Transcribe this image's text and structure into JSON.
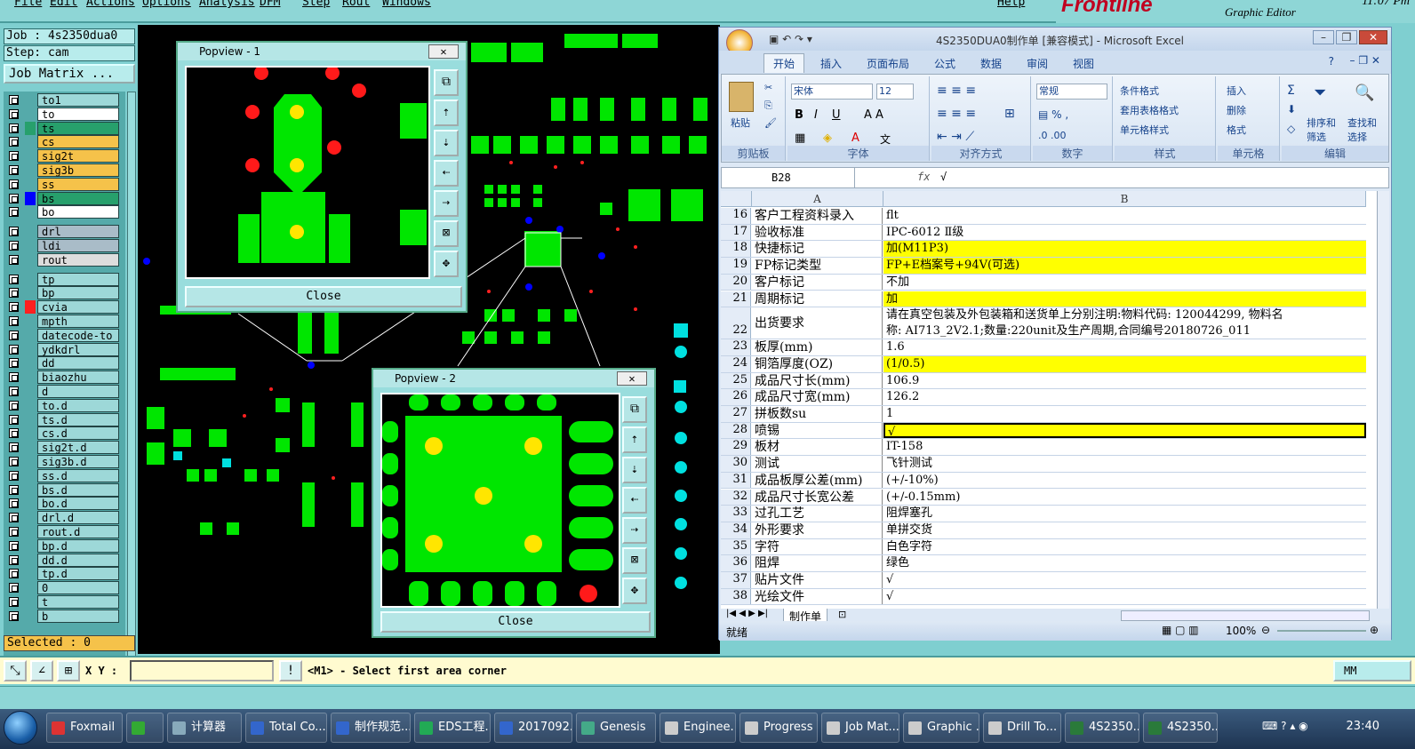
{
  "genesis": {
    "menu": [
      "File",
      "Edit",
      "Actions",
      "Options",
      "Analysis",
      "DFM",
      "Step",
      "Rout",
      "Windows",
      "Help"
    ],
    "brand": "Frontline",
    "brand_sub": "Graphic Editor",
    "time": "11:07 Pm",
    "job": "Job : 4s2350dua0",
    "step": "Step: cam",
    "job_matrix": "Job Matrix ...",
    "selected": "Selected : 0",
    "layers": [
      {
        "name": "to1",
        "color": "#9dd8d8"
      },
      {
        "name": "to",
        "color": "#ffffff"
      },
      {
        "name": "ts",
        "color": "#27a06c"
      },
      {
        "name": "cs",
        "color": "#f5c24a"
      },
      {
        "name": "sig2t",
        "color": "#f5c24a"
      },
      {
        "name": "sig3b",
        "color": "#f5c24a"
      },
      {
        "name": "ss",
        "color": "#f5c24a"
      },
      {
        "name": "bs",
        "color": "#27a06c"
      },
      {
        "name": "bo",
        "color": "#ffffff"
      },
      {
        "name": "drl",
        "color": "#a9bcc8"
      },
      {
        "name": "ldi",
        "color": "#a9bcc8"
      },
      {
        "name": "rout",
        "color": "#dddddd"
      },
      {
        "name": "tp",
        "color": "#9dd8d8"
      },
      {
        "name": "bp",
        "color": "#9dd8d8"
      },
      {
        "name": "cvia",
        "color": "#9dd8d8"
      },
      {
        "name": "mpth",
        "color": "#9dd8d8"
      },
      {
        "name": "datecode-to",
        "color": "#9dd8d8"
      },
      {
        "name": "ydkdrl",
        "color": "#9dd8d8"
      },
      {
        "name": "dd",
        "color": "#9dd8d8"
      },
      {
        "name": "biaozhu",
        "color": "#9dd8d8"
      },
      {
        "name": "d",
        "color": "#9dd8d8"
      },
      {
        "name": "to.d",
        "color": "#9dd8d8"
      },
      {
        "name": "ts.d",
        "color": "#9dd8d8"
      },
      {
        "name": "cs.d",
        "color": "#9dd8d8"
      },
      {
        "name": "sig2t.d",
        "color": "#9dd8d8"
      },
      {
        "name": "sig3b.d",
        "color": "#9dd8d8"
      },
      {
        "name": "ss.d",
        "color": "#9dd8d8"
      },
      {
        "name": "bs.d",
        "color": "#9dd8d8"
      },
      {
        "name": "bo.d",
        "color": "#9dd8d8"
      },
      {
        "name": "drl.d",
        "color": "#9dd8d8"
      },
      {
        "name": "rout.d",
        "color": "#9dd8d8"
      },
      {
        "name": "bp.d",
        "color": "#9dd8d8"
      },
      {
        "name": "dd.d",
        "color": "#9dd8d8"
      },
      {
        "name": "tp.d",
        "color": "#9dd8d8"
      },
      {
        "name": "0",
        "color": "#9dd8d8"
      },
      {
        "name": "t",
        "color": "#9dd8d8"
      },
      {
        "name": "b",
        "color": "#9dd8d8"
      }
    ],
    "popup1_title": "Popview - 1",
    "popup2_title": "Popview - 2",
    "close_label": "Close",
    "xy_label": "X Y :",
    "prompt": "<M1> - Select first area corner",
    "units": "MM"
  },
  "excel": {
    "title": "4S2350DUA0制作单 [兼容模式] - Microsoft Excel",
    "tabs": [
      "开始",
      "插入",
      "页面布局",
      "公式",
      "数据",
      "审阅",
      "视图"
    ],
    "font_name": "宋体",
    "font_size": "12",
    "number_format": "常规",
    "groups": [
      "剪贴板",
      "字体",
      "对齐方式",
      "数字",
      "样式",
      "单元格",
      "编辑"
    ],
    "paste": "粘贴",
    "styles": [
      "条件格式",
      "套用表格格式",
      "单元格样式"
    ],
    "cells_btns": [
      "插入",
      "删除",
      "格式"
    ],
    "sort": "排序和筛选",
    "find": "查找和选择",
    "name_box": "B28",
    "formula": "√",
    "col_a": "A",
    "col_b": "B",
    "rows": [
      {
        "n": "16",
        "a": "客户工程资料录入",
        "b": "flt",
        "hl": false
      },
      {
        "n": "17",
        "a": "验收标准",
        "b": "IPC-6012 Ⅱ级",
        "hl": false
      },
      {
        "n": "18",
        "a": "快捷标记",
        "b": "加(M11P3)",
        "hl": true
      },
      {
        "n": "19",
        "a": "FP标记类型",
        "b": "FP+E档案号+94V(可选)",
        "hl": true
      },
      {
        "n": "20",
        "a": "客户标记",
        "b": "不加",
        "hl": false
      },
      {
        "n": "21",
        "a": "周期标记",
        "b": "加",
        "hl": true
      },
      {
        "n": "22",
        "a": "出货要求",
        "b": "请在真空包装及外包装箱和送货单上分别注明:物料代码: 120044299, 物料名",
        "b2": "称: AI713_2V2.1;数量:220unit及生产周期,合同编号20180726_011",
        "hl": false,
        "tall": true
      },
      {
        "n": "23",
        "a": "板厚(mm)",
        "b": "1.6",
        "hl": false
      },
      {
        "n": "24",
        "a": "铜箔厚度(OZ)",
        "b": " (1/0.5)",
        "hl": true
      },
      {
        "n": "25",
        "a": "成品尺寸长(mm)",
        "b": "106.9",
        "hl": false
      },
      {
        "n": "26",
        "a": "成品尺寸宽(mm)",
        "b": "126.2",
        "hl": false
      },
      {
        "n": "27",
        "a": "拼板数su",
        "b": "1",
        "hl": false
      },
      {
        "n": "28",
        "a": "喷锡",
        "b": "√",
        "hl": true
      },
      {
        "n": "29",
        "a": "板材",
        "b": "IT-158",
        "hl": false
      },
      {
        "n": "30",
        "a": "测试",
        "b": "飞针测试",
        "hl": false
      },
      {
        "n": "31",
        "a": "成品板厚公差(mm)",
        "b": "(+/-10%)",
        "hl": false
      },
      {
        "n": "32",
        "a": "成品尺寸长宽公差",
        "b": "(+/-0.15mm)",
        "hl": false
      },
      {
        "n": "33",
        "a": "过孔工艺",
        "b": "阻焊塞孔",
        "hl": false
      },
      {
        "n": "34",
        "a": "外形要求",
        "b": "单拼交货",
        "hl": false
      },
      {
        "n": "35",
        "a": "字符",
        "b": "白色字符",
        "hl": false
      },
      {
        "n": "36",
        "a": "阻焊",
        "b": "绿色",
        "hl": false
      },
      {
        "n": "37",
        "a": "贴片文件",
        "b": "√",
        "hl": false
      },
      {
        "n": "38",
        "a": "光绘文件",
        "b": "√",
        "hl": false
      }
    ],
    "sheet_tab": "制作单",
    "status": "就绪",
    "zoom": "100%"
  },
  "taskbar": {
    "items": [
      {
        "label": "Foxmail",
        "color": "#d33"
      },
      {
        "label": "",
        "color": "#3a3"
      },
      {
        "label": "计算器",
        "color": "#8ab"
      },
      {
        "label": "Total Co...",
        "color": "#36c"
      },
      {
        "label": "制作规范...",
        "color": "#36c"
      },
      {
        "label": "EDS工程...",
        "color": "#2a5"
      },
      {
        "label": "2017092...",
        "color": "#36c"
      },
      {
        "label": "Genesis",
        "color": "#4a8"
      },
      {
        "label": "Enginee...",
        "color": "#ccc"
      },
      {
        "label": "Progress",
        "color": "#ccc"
      },
      {
        "label": "Job Mat...",
        "color": "#ccc"
      },
      {
        "label": "Graphic ...",
        "color": "#ccc"
      },
      {
        "label": "Drill To...",
        "color": "#ccc"
      },
      {
        "label": "4S2350...",
        "color": "#2a7a3a"
      },
      {
        "label": "4S2350...",
        "color": "#2a7a3a"
      }
    ],
    "clock": "23:40"
  }
}
